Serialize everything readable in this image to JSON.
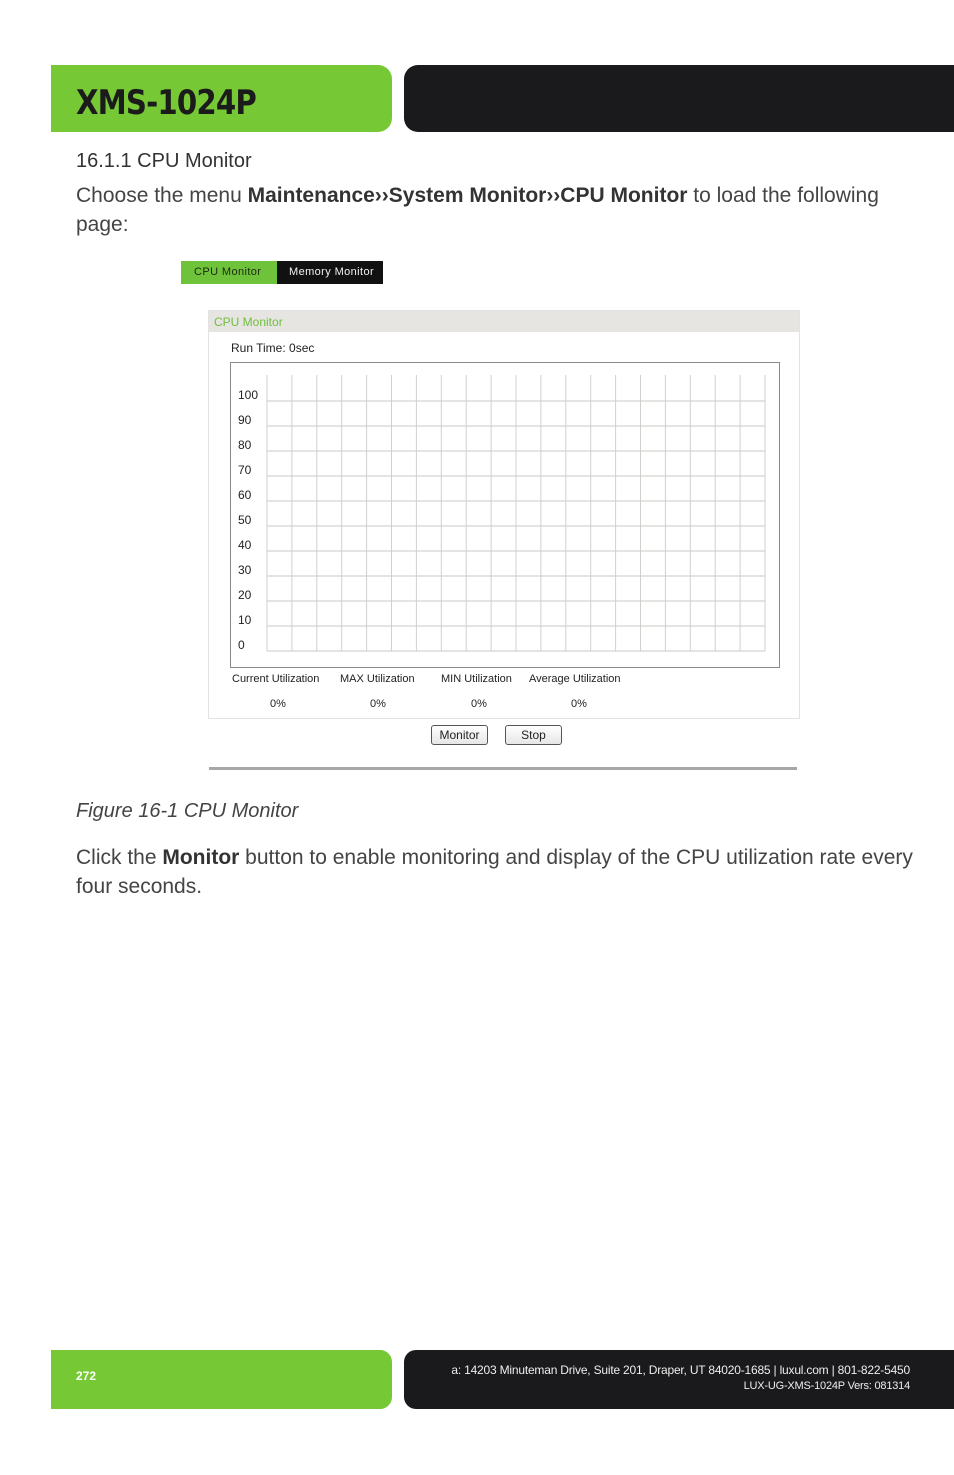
{
  "header": {
    "product": "XMS-1024P",
    "accent_color": "#76c935",
    "dark_color": "#1a191b"
  },
  "section": {
    "title": "16.1.1 CPU Monitor",
    "intro_before": "Choose the menu ",
    "intro_bold": "Maintenance››System Monitor››CPU Monitor",
    "intro_after": " to load the following page:"
  },
  "figure": {
    "tabs": [
      {
        "label": "CPU Monitor",
        "active": true
      },
      {
        "label": "Memory Monitor",
        "active": false
      }
    ],
    "panel_title": "CPU Monitor",
    "run_time": "Run Time: 0sec",
    "stats": [
      {
        "label": "Current Utilization",
        "value": "0%"
      },
      {
        "label": "MAX Utilization",
        "value": "0%"
      },
      {
        "label": "MIN Utilization",
        "value": "0%"
      },
      {
        "label": "Average Utilization",
        "value": "0%"
      }
    ],
    "buttons": {
      "monitor": "Monitor",
      "stop": "Stop"
    },
    "caption": "Figure 16-1 CPU Monitor"
  },
  "chart_data": {
    "type": "line",
    "title": "CPU Monitor",
    "xlabel": "",
    "ylabel": "",
    "yticks": [
      "100",
      "90",
      "80",
      "70",
      "60",
      "50",
      "40",
      "30",
      "20",
      "10",
      "0"
    ],
    "ylim": [
      0,
      100
    ],
    "x_divisions": 20,
    "grid": true,
    "series": []
  },
  "body": {
    "before": "Click the ",
    "bold": "Monitor",
    "after": " button to enable monitoring and display of the CPU utilization rate every four seconds."
  },
  "footer": {
    "page_number": "272",
    "address": "a: 14203 Minuteman Drive, Suite 201, Draper, UT 84020-1685 | luxul.com | 801-822-5450",
    "doc_id": "LUX-UG-XMS-1024P  Vers: 081314"
  }
}
